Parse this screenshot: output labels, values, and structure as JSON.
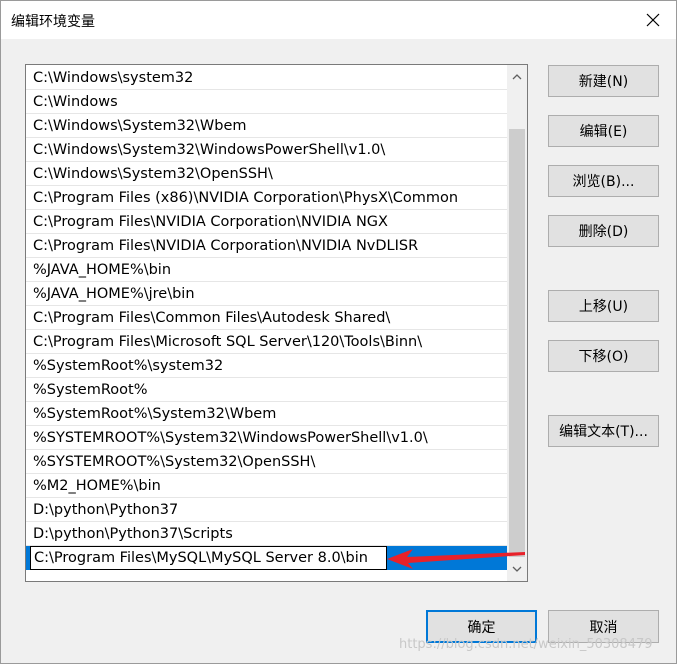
{
  "window": {
    "title": "编辑环境变量"
  },
  "path_list": {
    "items": [
      "C:\\Windows\\system32",
      "C:\\Windows",
      "C:\\Windows\\System32\\Wbem",
      "C:\\Windows\\System32\\WindowsPowerShell\\v1.0\\",
      "C:\\Windows\\System32\\OpenSSH\\",
      "C:\\Program Files (x86)\\NVIDIA Corporation\\PhysX\\Common",
      "C:\\Program Files\\NVIDIA Corporation\\NVIDIA NGX",
      "C:\\Program Files\\NVIDIA Corporation\\NVIDIA NvDLISR",
      "%JAVA_HOME%\\bin",
      "%JAVA_HOME%\\jre\\bin",
      "C:\\Program Files\\Common Files\\Autodesk Shared\\",
      "C:\\Program Files\\Microsoft SQL Server\\120\\Tools\\Binn\\",
      "%SystemRoot%\\system32",
      "%SystemRoot%",
      "%SystemRoot%\\System32\\Wbem",
      "%SYSTEMROOT%\\System32\\WindowsPowerShell\\v1.0\\",
      "%SYSTEMROOT%\\System32\\OpenSSH\\",
      "%M2_HOME%\\bin",
      "D:\\python\\Python37",
      "D:\\python\\Python37\\Scripts"
    ],
    "editing_value": "C:\\Program Files\\MySQL\\MySQL Server 8.0\\bin"
  },
  "buttons": {
    "new": "新建(N)",
    "edit": "编辑(E)",
    "browse": "浏览(B)...",
    "delete": "删除(D)",
    "move_up": "上移(U)",
    "move_down": "下移(O)",
    "edit_text": "编辑文本(T)...",
    "ok": "确定",
    "cancel": "取消"
  },
  "watermark": "https://blog.csdn.net/weixin_50308479",
  "colors": {
    "selection": "#0078d7",
    "annotation_arrow": "#e8212a"
  }
}
